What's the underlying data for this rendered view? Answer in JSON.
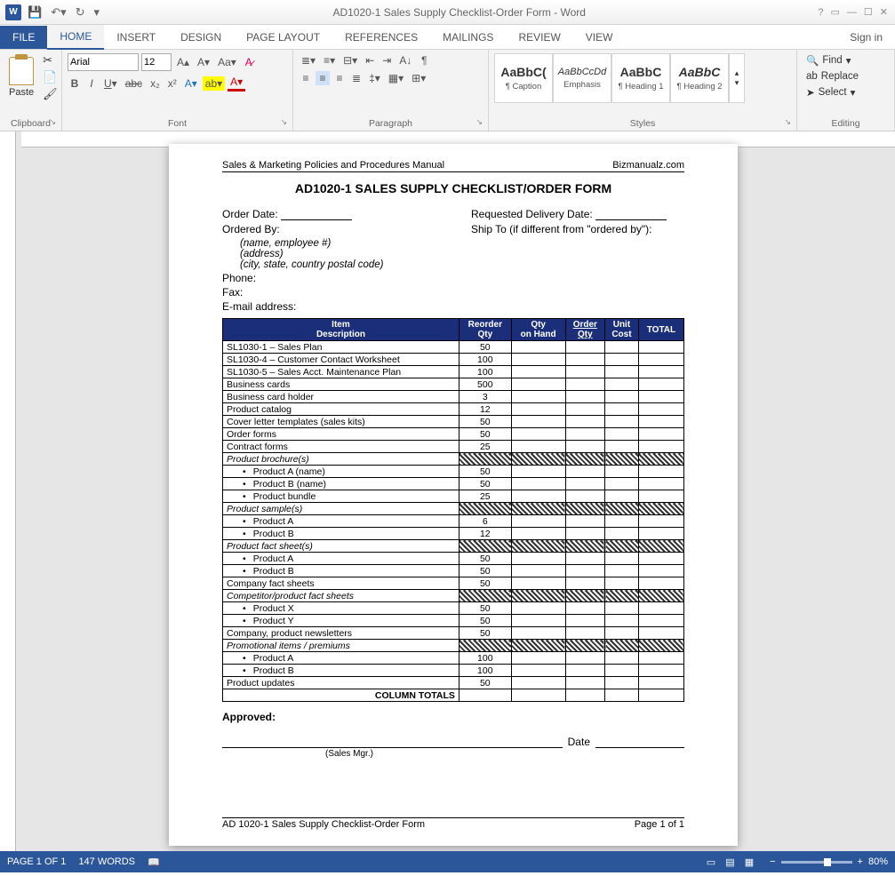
{
  "titlebar": {
    "title": "AD1020-1 Sales Supply Checklist-Order Form - Word",
    "signin": "Sign in"
  },
  "ribbon": {
    "file": "FILE",
    "tabs": [
      "HOME",
      "INSERT",
      "DESIGN",
      "PAGE LAYOUT",
      "REFERENCES",
      "MAILINGS",
      "REVIEW",
      "VIEW"
    ],
    "active": "HOME",
    "clipboard": {
      "paste": "Paste",
      "label": "Clipboard"
    },
    "font": {
      "name": "Arial",
      "size": "12",
      "label": "Font"
    },
    "paragraph": {
      "label": "Paragraph"
    },
    "styles": {
      "label": "Styles",
      "items": [
        {
          "preview": "AaBbC(",
          "name": "¶ Caption",
          "css": "font-weight:bold;"
        },
        {
          "preview": "AaBbCcDd",
          "name": "Emphasis",
          "css": "font-style:italic;font-size:11px;"
        },
        {
          "preview": "AaBbC",
          "name": "¶ Heading 1",
          "css": "font-weight:bold;"
        },
        {
          "preview": "AaBbC",
          "name": "¶ Heading 2",
          "css": "font-weight:bold;font-style:italic;"
        }
      ]
    },
    "editing": {
      "find": "Find",
      "replace": "Replace",
      "select": "Select",
      "label": "Editing"
    }
  },
  "doc": {
    "header_left": "Sales & Marketing Policies and Procedures Manual",
    "header_right": "Bizmanualz.com",
    "title": "AD1020-1 SALES SUPPLY CHECKLIST/ORDER FORM",
    "order_date_lbl": "Order Date:",
    "req_date_lbl": "Requested Delivery Date:",
    "ordered_by_lbl": "Ordered By:",
    "ship_to_lbl": "Ship To (if different from \"ordered by\"):",
    "line1": "(name, employee #)",
    "line2": "(address)",
    "line3": "(city, state, country postal code)",
    "phone": "Phone:",
    "fax": "Fax:",
    "email": "E-mail address:",
    "th": [
      "Item Description",
      "Reorder Qty",
      "Qty on Hand",
      "Order Qty",
      "Unit Cost",
      "TOTAL"
    ],
    "rows": [
      {
        "t": "r",
        "d": "SL1030-1 – Sales Plan",
        "q": "50"
      },
      {
        "t": "r",
        "d": "SL1030-4 – Customer Contact Worksheet",
        "q": "100"
      },
      {
        "t": "r",
        "d": "SL1030-5 – Sales Acct. Maintenance Plan",
        "q": "100"
      },
      {
        "t": "r",
        "d": "Business cards",
        "q": "500"
      },
      {
        "t": "r",
        "d": "Business card holder",
        "q": "3"
      },
      {
        "t": "r",
        "d": "Product catalog",
        "q": "12"
      },
      {
        "t": "r",
        "d": "Cover letter templates (sales kits)",
        "q": "50"
      },
      {
        "t": "r",
        "d": "Order forms",
        "q": "50"
      },
      {
        "t": "r",
        "d": "Contract forms",
        "q": "25"
      },
      {
        "t": "c",
        "d": "Product brochure(s)"
      },
      {
        "t": "b",
        "d": "Product A (name)",
        "q": "50"
      },
      {
        "t": "b",
        "d": "Product B (name)",
        "q": "50"
      },
      {
        "t": "b",
        "d": "Product bundle",
        "q": "25"
      },
      {
        "t": "c",
        "d": "Product sample(s)"
      },
      {
        "t": "b",
        "d": "Product A",
        "q": "6"
      },
      {
        "t": "b",
        "d": "Product B",
        "q": "12"
      },
      {
        "t": "c",
        "d": "Product fact sheet(s)"
      },
      {
        "t": "b",
        "d": "Product A",
        "q": "50"
      },
      {
        "t": "b",
        "d": "Product B",
        "q": "50"
      },
      {
        "t": "r",
        "d": "Company fact sheets",
        "q": "50"
      },
      {
        "t": "c",
        "d": "Competitor/product fact sheets"
      },
      {
        "t": "b",
        "d": "Product X",
        "q": "50"
      },
      {
        "t": "b",
        "d": "Product Y",
        "q": "50"
      },
      {
        "t": "r",
        "d": "Company, product newsletters",
        "q": "50"
      },
      {
        "t": "c",
        "d": "Promotional items / premiums"
      },
      {
        "t": "b",
        "d": "Product A",
        "q": "100"
      },
      {
        "t": "b",
        "d": "Product B",
        "q": "100"
      },
      {
        "t": "r",
        "d": "Product updates",
        "q": "50"
      }
    ],
    "col_totals": "COLUMN TOTALS",
    "approved": "Approved:",
    "date": "Date",
    "sigmgr": "(Sales Mgr.)",
    "footer_left": "AD 1020-1 Sales Supply Checklist-Order Form",
    "footer_right": "Page 1 of 1"
  },
  "status": {
    "page": "PAGE 1 OF 1",
    "words": "147 WORDS",
    "zoom": "80%"
  }
}
